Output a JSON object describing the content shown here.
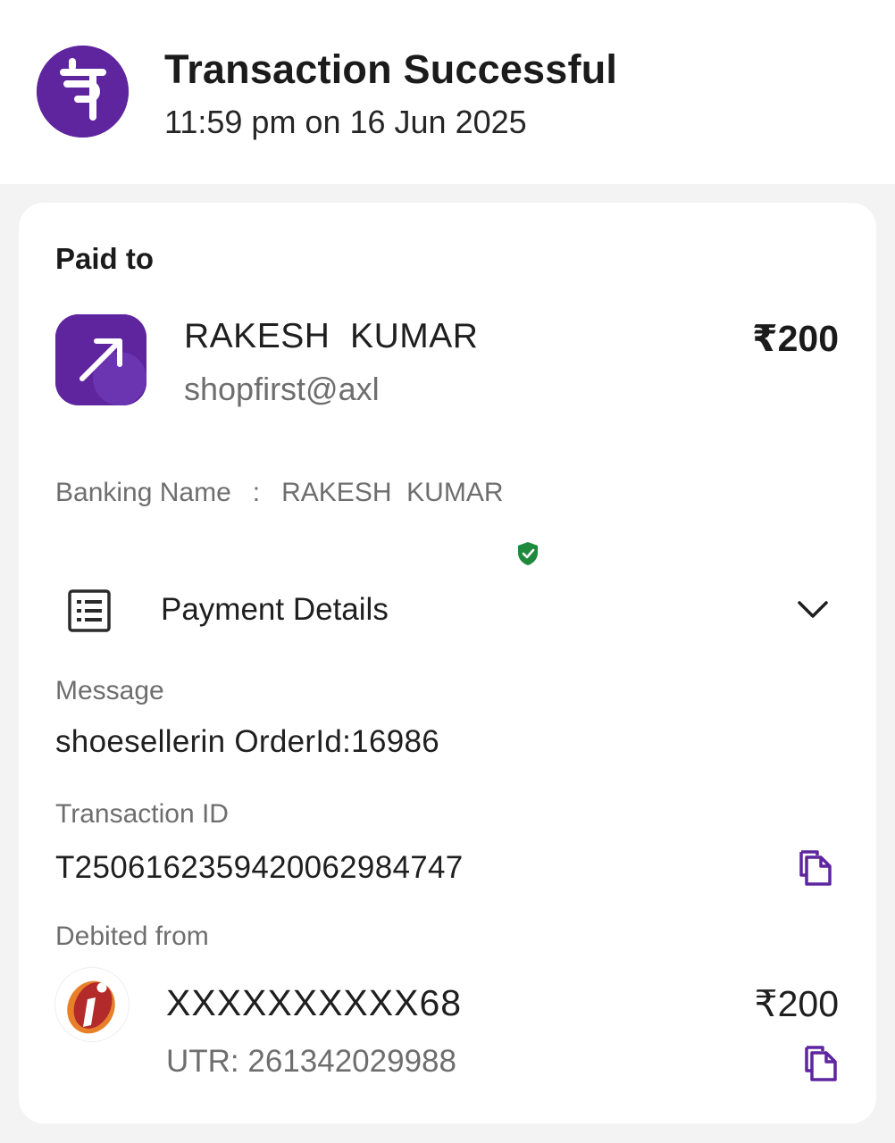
{
  "header": {
    "brand_icon": "phonepe-logo",
    "title": "Transaction Successful",
    "timestamp": "11:59 pm on 16 Jun 2025"
  },
  "paid_to": {
    "label": "Paid to",
    "icon": "arrow-up-right-icon",
    "name": "RAKESH  KUMAR",
    "upi_id": "shopfirst@axl",
    "amount": "₹200"
  },
  "banking": {
    "label": "Banking Name",
    "separator": ":",
    "name": "RAKESH  KUMAR",
    "verified_icon": "verified-shield-icon"
  },
  "payment_details": {
    "label": "Payment Details",
    "icon": "receipt-icon",
    "toggle_icon": "chevron-down-icon",
    "message_label": "Message",
    "message_value": "shoesellerin OrderId:16986",
    "transaction_id_label": "Transaction ID",
    "transaction_id_value": "T2506162359420062984747"
  },
  "debited_from": {
    "label": "Debited from",
    "bank_icon": "icici-bank-logo",
    "account": "XXXXXXXXXX68",
    "utr": "UTR: 261342029988",
    "amount": "₹200"
  },
  "colors": {
    "brand": "#5f259f",
    "verified": "#1f8a3b",
    "background": "#f3f3f3"
  }
}
